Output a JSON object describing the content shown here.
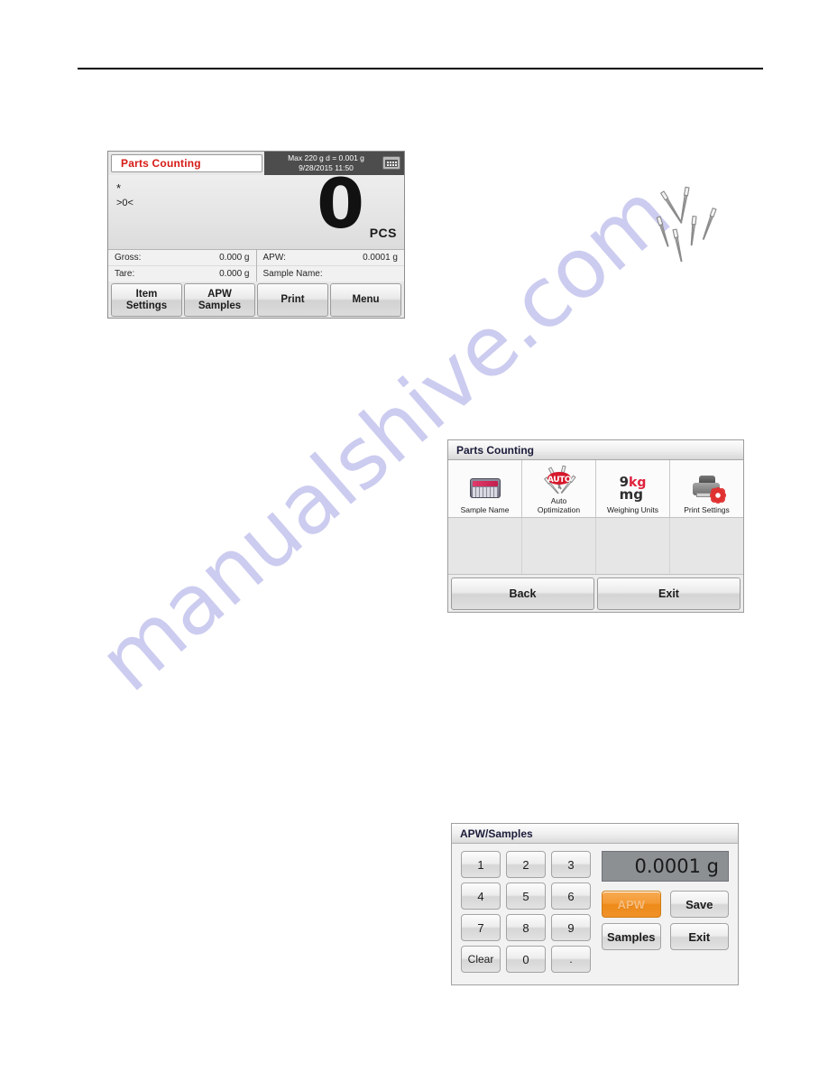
{
  "page": {
    "watermark": "manualshive.com"
  },
  "scale_display": {
    "mode_label": "Parts Counting",
    "capacity_line": "Max 220 g   d = 0.001 g",
    "datetime_line": "9/28/2015   11:50",
    "status_icon": "printer-icon",
    "stability_flag": "*",
    "zero_flag": ">0<",
    "weight_value": "0",
    "weight_unit": "PCS",
    "info_rows": [
      {
        "label": "Gross:",
        "value": "0.000 g"
      },
      {
        "label": "Tare:",
        "value": "0.000 g"
      },
      {
        "label": "APW:",
        "value": "0.0001 g"
      },
      {
        "label": "Sample Name:",
        "value": ""
      }
    ],
    "buttons": [
      {
        "line1": "Item",
        "line2": "Settings"
      },
      {
        "line1": "APW",
        "line2": "Samples"
      },
      {
        "line1": "Print",
        "line2": ""
      },
      {
        "line1": "Menu",
        "line2": ""
      }
    ]
  },
  "menu_panel": {
    "title": "Parts Counting",
    "items": [
      {
        "label": "Sample Name",
        "icon": "keyboard-icon"
      },
      {
        "label": "Auto\nOptimization",
        "label_line1": "Auto",
        "label_line2": "Optimization",
        "icon": "auto-nails-icon"
      },
      {
        "label": "Weighing Units",
        "icon": "units-icon",
        "icon_text_g": "9",
        "icon_text_kg": "kg",
        "icon_text_mg": "mg"
      },
      {
        "label": "Print Settings",
        "icon": "printer-gear-icon"
      }
    ],
    "footer_buttons": [
      {
        "label": "Back"
      },
      {
        "label": "Exit"
      }
    ]
  },
  "keypad_panel": {
    "title": "APW/Samples",
    "display_value": "0.0001 g",
    "keys": [
      {
        "label": "1"
      },
      {
        "label": "2"
      },
      {
        "label": "3"
      },
      {
        "label": "4"
      },
      {
        "label": "5"
      },
      {
        "label": "6"
      },
      {
        "label": "7"
      },
      {
        "label": "8"
      },
      {
        "label": "9"
      },
      {
        "label": "Clear"
      },
      {
        "label": "0"
      },
      {
        "label": "."
      }
    ],
    "actions": [
      {
        "label": "APW",
        "active": true
      },
      {
        "label": "Save",
        "active": false
      },
      {
        "label": "Samples",
        "active": false
      },
      {
        "label": "Exit",
        "active": false
      }
    ]
  },
  "illustration": {
    "name": "nails-cluster",
    "count": 6
  },
  "colors": {
    "mode_red": "#d61a15",
    "accent_orange": "#ef8c18",
    "icon_red": "#e0203a",
    "watermark": "#ccccf0",
    "topbar_dark": "#4d4d4d"
  }
}
